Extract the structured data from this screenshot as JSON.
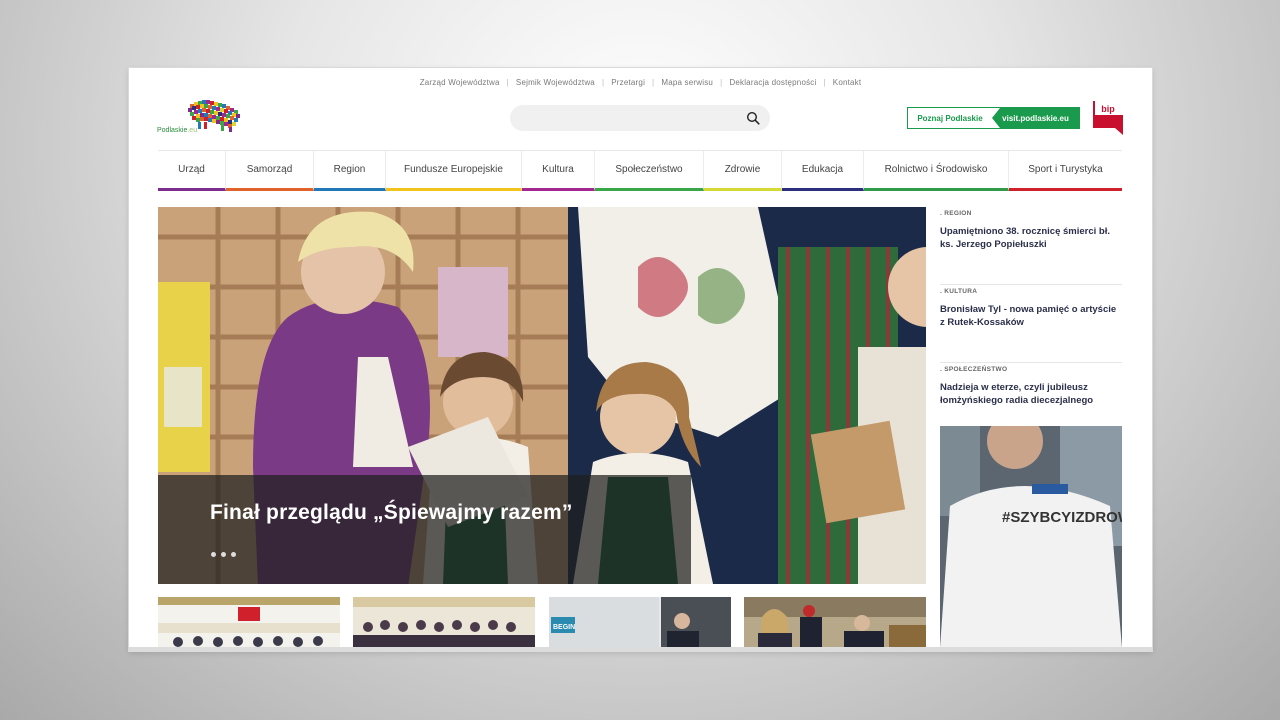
{
  "topnav": {
    "items": [
      "Zarząd Województwa",
      "Sejmik Województwa",
      "Przetargi",
      "Mapa serwisu",
      "Deklaracja dostępności",
      "Kontakt"
    ]
  },
  "logo": {
    "text_main": "Podlaskie",
    "text_suffix": ".eu"
  },
  "search": {
    "placeholder": "",
    "icon": "search-icon"
  },
  "visit": {
    "left_label": "Poznaj Podlaskie",
    "right_label": "visit.podlaskie.eu",
    "color": "#1a9a4c"
  },
  "bip": {
    "label": "bip",
    "color": "#c8102e"
  },
  "nav": {
    "items": [
      {
        "label": "Urząd",
        "color": "#7b2d8e"
      },
      {
        "label": "Samorząd",
        "color": "#e2622c"
      },
      {
        "label": "Region",
        "color": "#2378b7"
      },
      {
        "label": "Fundusze Europejskie",
        "color": "#f2c31b"
      },
      {
        "label": "Kultura",
        "color": "#a2278e"
      },
      {
        "label": "Społeczeństwo",
        "color": "#3aa64a"
      },
      {
        "label": "Zdrowie",
        "color": "#d6d934"
      },
      {
        "label": "Edukacja",
        "color": "#2b2f7d"
      },
      {
        "label": "Rolnictwo i Środowisko",
        "color": "#2e9a4a"
      },
      {
        "label": "Sport i Turystyka",
        "color": "#d0202b"
      }
    ]
  },
  "hero": {
    "title": "Finał przeglądu „Śpiewajmy razem”",
    "slides": 3
  },
  "sidebar": {
    "items": [
      {
        "category": ". REGION",
        "title": "Upamiętniono 38. rocznicę śmierci bł. ks. Jerzego Popiełuszki"
      },
      {
        "category": ". KULTURA",
        "title": "Bronisław Tyl - nowa pamięć o artyście z Rutek-Kossaków"
      },
      {
        "category": ". SPOŁECZEŃSTWO",
        "title": "Nadzieja w eterze, czyli jubileusz łomżyńskiego radia diecezjalnego"
      }
    ],
    "photo_text": "#SZYBCYIZDROWI"
  },
  "thumbs": {
    "third_text": "BEGIN"
  }
}
